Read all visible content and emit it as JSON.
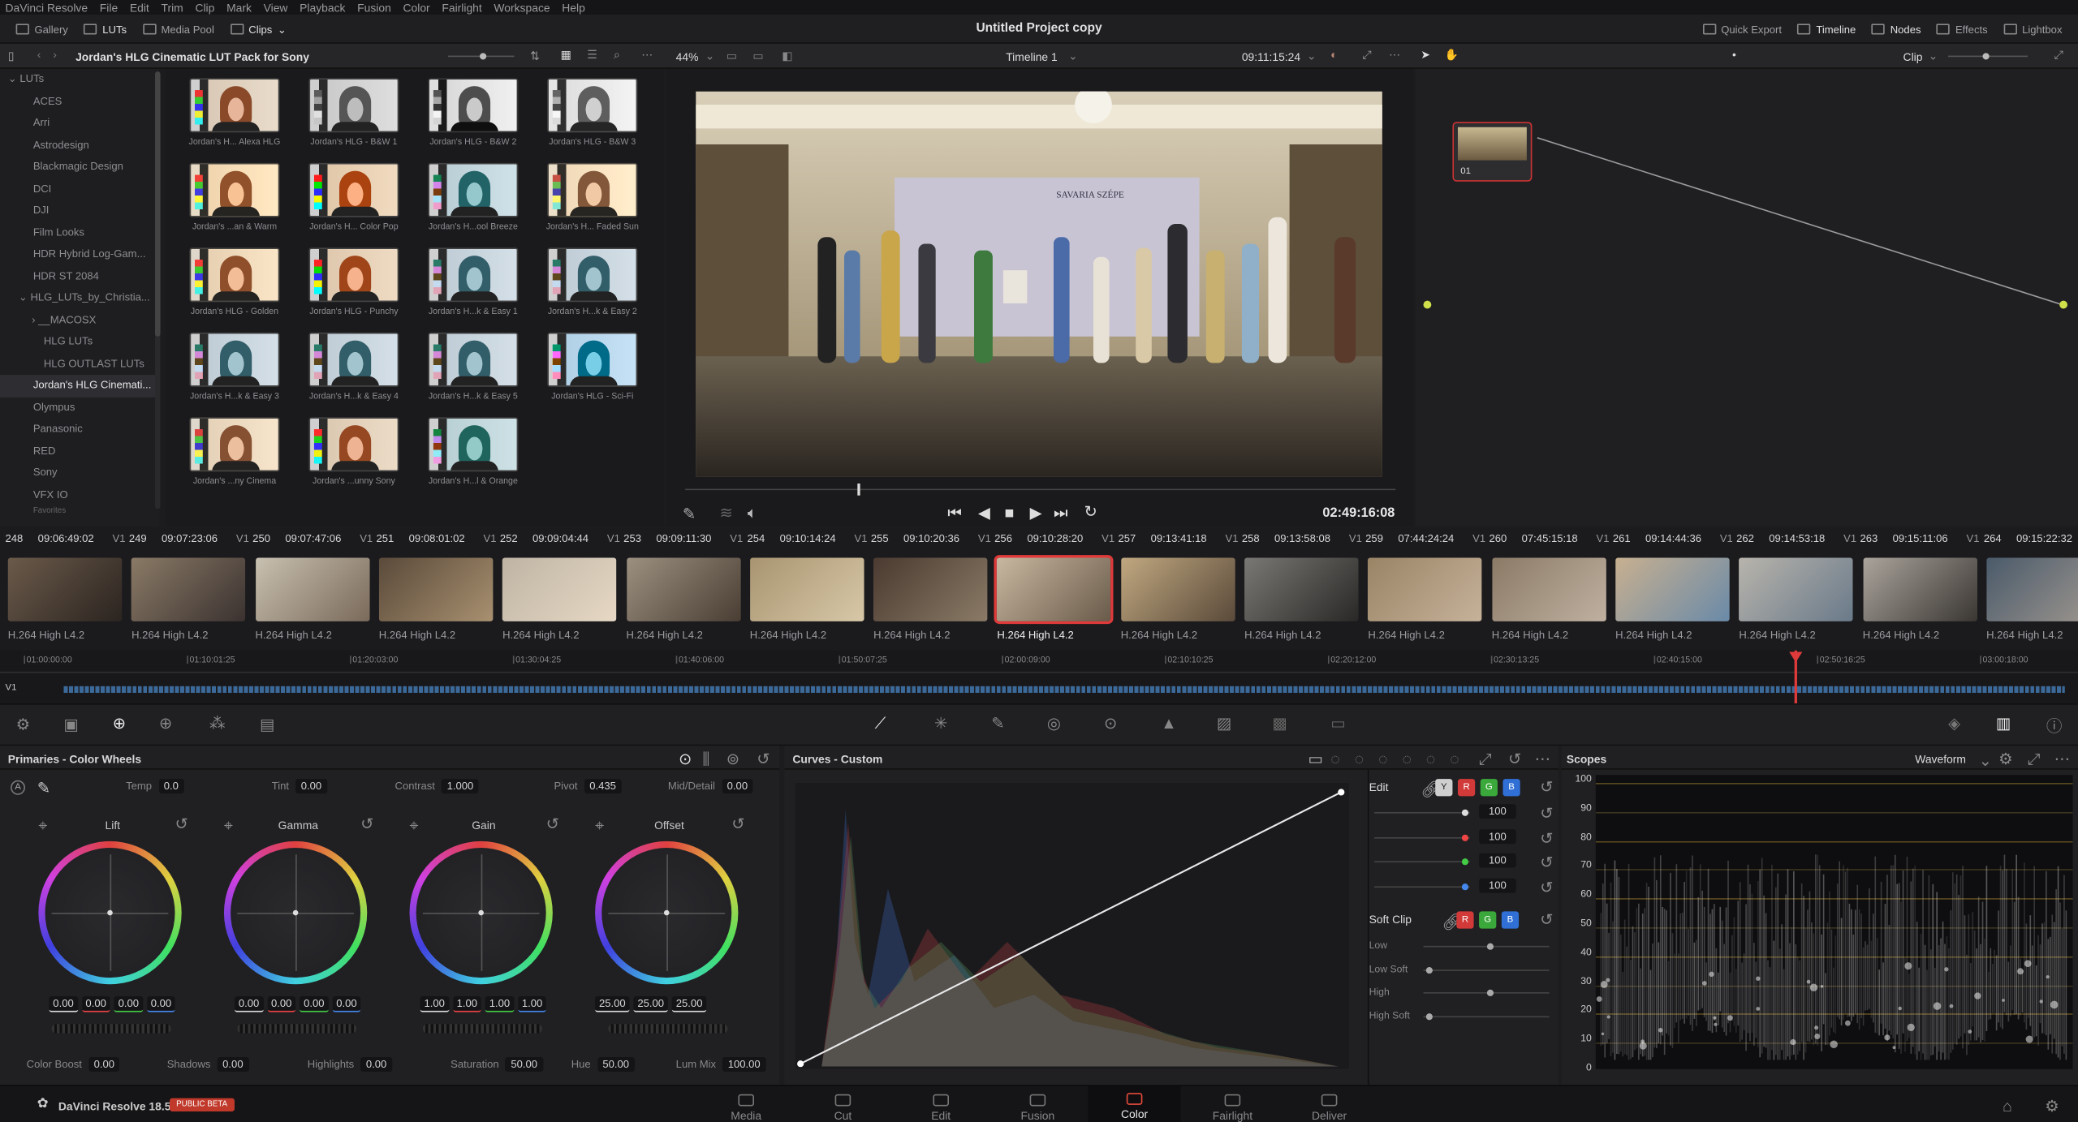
{
  "menubar": [
    "DaVinci Resolve",
    "File",
    "Edit",
    "Trim",
    "Clip",
    "Mark",
    "View",
    "Playback",
    "Fusion",
    "Color",
    "Fairlight",
    "Workspace",
    "Help"
  ],
  "topbar": {
    "left": [
      "Gallery",
      "LUTs",
      "Media Pool",
      "Clips"
    ],
    "title": "Untitled Project copy",
    "right": [
      "Quick Export",
      "Timeline",
      "Nodes",
      "Effects",
      "Lightbox"
    ]
  },
  "bar2": {
    "lut_pack": "Jordan's HLG Cinematic LUT Pack for Sony",
    "zoom": "44%",
    "timeline": "Timeline 1",
    "timecode": "09:11:15:24",
    "clip_mode": "Clip"
  },
  "lut_tree": [
    "LUTs",
    "ACES",
    "Arri",
    "Astrodesign",
    "Blackmagic Design",
    "DCI",
    "DJI",
    "Film Looks",
    "HDR Hybrid Log-Gam...",
    "HDR ST 2084",
    "HLG_LUTs_by_Christia...",
    "__MACOSX",
    "HLG LUTs",
    "HLG OUTLAST LUTs",
    "Jordan's HLG Cinemati...",
    "Olympus",
    "Panasonic",
    "RED",
    "Sony",
    "VFX IO",
    "Favorites"
  ],
  "luts": [
    "Jordan's H... Alexa HLG",
    "Jordan's HLG - B&W 1",
    "Jordan's HLG - B&W 2",
    "Jordan's HLG - B&W 3",
    "Jordan's ...an & Warm",
    "Jordan's H... Color Pop",
    "Jordan's H...ool Breeze",
    "Jordan's H... Faded Sun",
    "Jordan's HLG - Golden",
    "Jordan's HLG - Punchy",
    "Jordan's H...k & Easy 1",
    "Jordan's H...k & Easy 2",
    "Jordan's H...k & Easy 3",
    "Jordan's H...k & Easy 4",
    "Jordan's H...k & Easy 5",
    "Jordan's HLG - Sci-Fi",
    "Jordan's ...ny Cinema",
    "Jordan's ...unny Sony",
    "Jordan's H...l & Orange"
  ],
  "viewer": {
    "record_tc": "02:49:16:08",
    "banner_text": "SAVARIA SZÉPE"
  },
  "node": {
    "label": "01"
  },
  "clips": [
    {
      "num": "248",
      "tc": "09:06:49:02",
      "track": "V1",
      "codec": "H.264 High L4.2"
    },
    {
      "num": "249",
      "tc": "09:07:23:06",
      "track": "V1",
      "codec": "H.264 High L4.2"
    },
    {
      "num": "250",
      "tc": "09:07:47:06",
      "track": "V1",
      "codec": "H.264 High L4.2"
    },
    {
      "num": "251",
      "tc": "09:08:01:02",
      "track": "V1",
      "codec": "H.264 High L4.2"
    },
    {
      "num": "252",
      "tc": "09:09:04:44",
      "track": "V1",
      "codec": "H.264 High L4.2"
    },
    {
      "num": "253",
      "tc": "09:09:11:30",
      "track": "V1",
      "codec": "H.264 High L4.2"
    },
    {
      "num": "254",
      "tc": "09:10:14:24",
      "track": "V1",
      "codec": "H.264 High L4.2"
    },
    {
      "num": "255",
      "tc": "09:10:20:36",
      "track": "V1",
      "codec": "H.264 High L4.2"
    },
    {
      "num": "256",
      "tc": "09:10:28:20",
      "track": "V1",
      "codec": "H.264 High L4.2"
    },
    {
      "num": "257",
      "tc": "09:13:41:18",
      "track": "V1",
      "codec": "H.264 High L4.2"
    },
    {
      "num": "258",
      "tc": "09:13:58:08",
      "track": "V1",
      "codec": "H.264 High L4.2"
    },
    {
      "num": "259",
      "tc": "07:44:24:24",
      "track": "V1",
      "codec": "H.264 High L4.2"
    },
    {
      "num": "260",
      "tc": "07:45:15:18",
      "track": "V1",
      "codec": "H.264 High L4.2"
    },
    {
      "num": "261",
      "tc": "09:14:44:36",
      "track": "V1",
      "codec": "H.264 High L4.2"
    },
    {
      "num": "262",
      "tc": "09:14:53:18",
      "track": "V1",
      "codec": "H.264 High L4.2"
    },
    {
      "num": "263",
      "tc": "09:15:11:06",
      "track": "V1",
      "codec": "H.264 High L4.2"
    },
    {
      "num": "264",
      "tc": "09:15:22:32",
      "track": "V1",
      "codec": "H.264 High L4.2"
    }
  ],
  "selected_clip": "256",
  "ruler": [
    "01:00:00:00",
    "01:10:01:25",
    "01:20:03:00",
    "01:30:04:25",
    "01:40:06:00",
    "01:50:07:25",
    "02:00:09:00",
    "02:10:10:25",
    "02:20:12:00",
    "02:30:13:25",
    "02:40:15:00",
    "02:50:16:25",
    "03:00:18:00"
  ],
  "ruler_track": "V1",
  "primaries": {
    "title": "Primaries - Color Wheels",
    "params": [
      {
        "label": "Temp",
        "value": "0.0"
      },
      {
        "label": "Tint",
        "value": "0.00"
      },
      {
        "label": "Contrast",
        "value": "1.000"
      },
      {
        "label": "Pivot",
        "value": "0.435"
      },
      {
        "label": "Mid/Detail",
        "value": "0.00"
      }
    ],
    "wheels": [
      {
        "name": "Lift",
        "values": [
          "0.00",
          "0.00",
          "0.00",
          "0.00"
        ]
      },
      {
        "name": "Gamma",
        "values": [
          "0.00",
          "0.00",
          "0.00",
          "0.00"
        ]
      },
      {
        "name": "Gain",
        "values": [
          "1.00",
          "1.00",
          "1.00",
          "1.00"
        ]
      },
      {
        "name": "Offset",
        "values": [
          "25.00",
          "25.00",
          "25.00"
        ]
      }
    ],
    "bottom": [
      {
        "label": "Color Boost",
        "value": "0.00"
      },
      {
        "label": "Shadows",
        "value": "0.00"
      },
      {
        "label": "Highlights",
        "value": "0.00"
      },
      {
        "label": "Saturation",
        "value": "50.00"
      },
      {
        "label": "Hue",
        "value": "50.00"
      },
      {
        "label": "Lum Mix",
        "value": "100.00"
      }
    ]
  },
  "curves": {
    "title": "Curves - Custom",
    "edit_label": "Edit",
    "channels": [
      "Y",
      "R",
      "G",
      "B"
    ],
    "intensity": [
      "100",
      "100",
      "100",
      "100"
    ],
    "soft_clip_label": "Soft Clip",
    "soft_clip": [
      "Low",
      "Low Soft",
      "High",
      "High Soft"
    ]
  },
  "scopes": {
    "title": "Scopes",
    "mode": "Waveform",
    "scale": [
      "100",
      "90",
      "80",
      "70",
      "60",
      "50",
      "40",
      "30",
      "20",
      "10",
      "0"
    ]
  },
  "footer": {
    "app": "DaVinci Resolve 18.5",
    "badge": "PUBLIC BETA",
    "pages": [
      "Media",
      "Cut",
      "Edit",
      "Fusion",
      "Color",
      "Fairlight",
      "Deliver"
    ],
    "active_page": "Color"
  },
  "colors": {
    "accent": "#e64b3c",
    "selected": "#e03a3a",
    "active": "#e8e8ea"
  }
}
